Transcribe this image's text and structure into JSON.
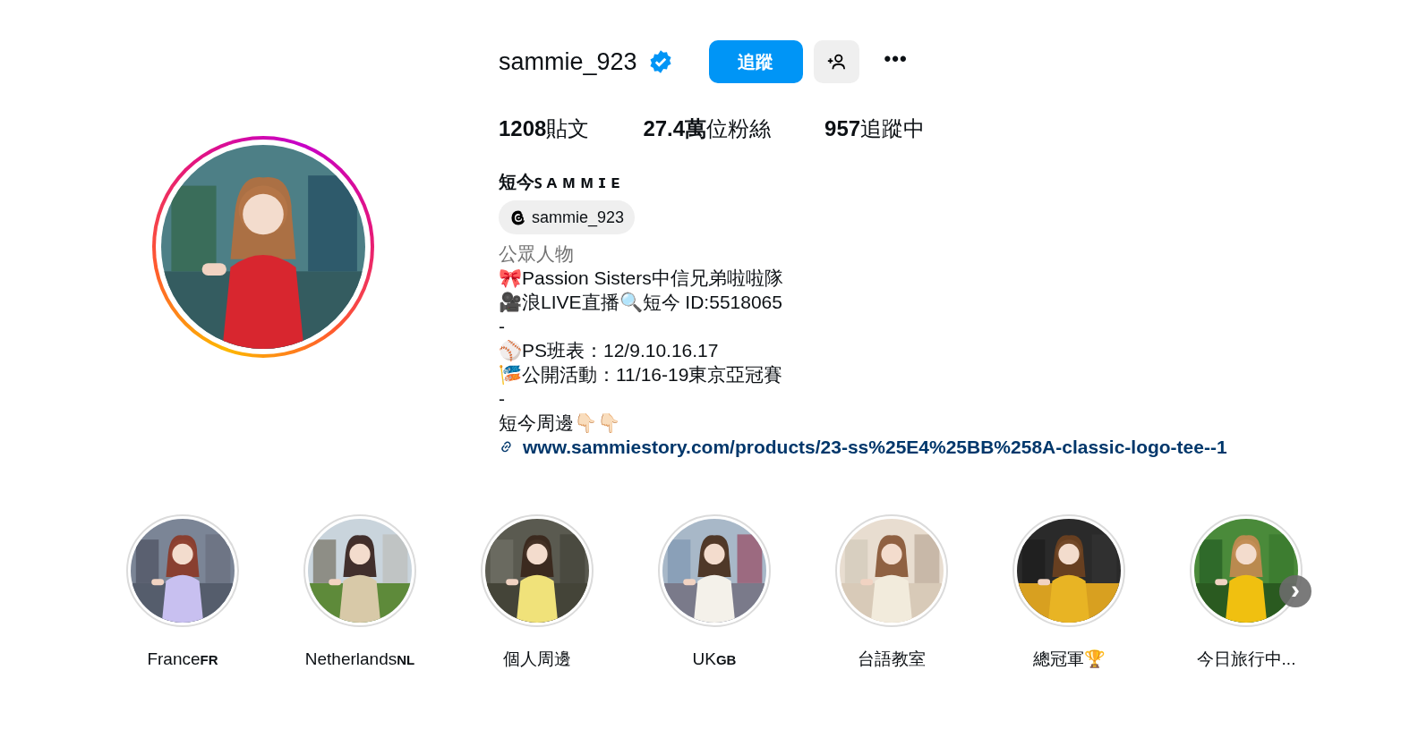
{
  "profile": {
    "username": "sammie_923",
    "verified": true,
    "follow_button": "追蹤",
    "more_button": "•••",
    "stats": [
      {
        "value": "1208",
        "label": "貼文"
      },
      {
        "value": "27.4萬",
        "label": "位粉絲"
      },
      {
        "value": "957",
        "label": "追蹤中"
      }
    ],
    "display_name": "短今ꜱ ᴀ ᴍ ᴍ ɪ ᴇ",
    "threads_handle": "sammie_923",
    "category": "公眾人物",
    "bio_lines": [
      "🎀Passion Sisters中信兄弟啦啦隊",
      "🎥浪LIVE直播🔍短今 ID:5518065",
      "-",
      "⚾PS班表：12/9.10.16.17",
      "🎏公開活動：11/16-19東京亞冠賽",
      "-",
      "短今周邊👇🏻👇🏻"
    ],
    "link": "www.sammiestory.com/products/23-ss%25E4%25BB%258A-classic-logo-tee--1"
  },
  "highlights": [
    {
      "label": "France",
      "badge": "FR",
      "kind": "picture"
    },
    {
      "label": "Netherlands",
      "badge": "NL",
      "kind": "picture"
    },
    {
      "label": "個人周邊",
      "kind": "picture"
    },
    {
      "label": "UK",
      "badge": "GB",
      "kind": "picture"
    },
    {
      "label": "台語教室",
      "kind": "picture"
    },
    {
      "label": "總冠軍🏆",
      "kind": "picture"
    },
    {
      "label": "今日旅行中...",
      "kind": "picture"
    }
  ],
  "next_button": "›"
}
